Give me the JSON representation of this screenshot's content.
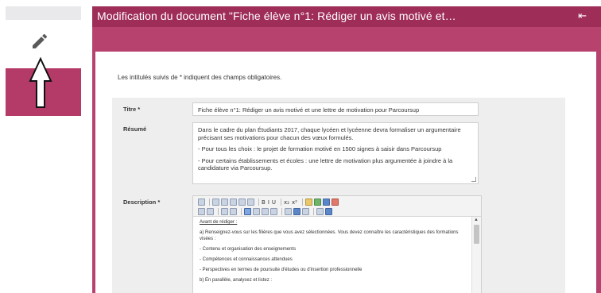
{
  "window": {
    "title": "Modification du document \"Fiche élève n°1: Rédiger un avis motivé et…",
    "collapse_icon": "⇤"
  },
  "notice": "Les intitulés suivis de * indiquent des champs obligatoires.",
  "form": {
    "title_label": "Titre *",
    "title_value": "Fiche élève n°1: Rédiger un avis motivé et une lettre de motivation pour Parcoursup",
    "summary_label": "Résumé",
    "summary_paragraphs": [
      "Dans le cadre du plan Étudiants 2017, chaque lycéen et lycéenne devra formaliser un argumentaire précisant ses motivations pour chacun des vœux formulés.",
      "- Pour tous les choix : le projet de formation motivé en 1500 signes à saisir dans Parcoursup",
      "- Pour certains établissements et écoles : une lettre de motivation plus argumentée à joindre à la candidature via Parcoursup."
    ],
    "description_label": "Description *",
    "editor_lines": [
      "Avant de rédiger :",
      "a) Renseignez-vous sur les filières que vous avez sélectionnées. Vous devez connaître les caractéristiques des formations visées :",
      "- Contenu et organisation des enseignements",
      "- Compétences et connaissances attendues",
      "- Perspectives en termes de poursuite d'études ou d'insertion professionnelle",
      "b) En parallèle, analysez et listez :"
    ]
  },
  "colors": {
    "brand": "#b8426e",
    "titlebar": "#9e2d58"
  }
}
